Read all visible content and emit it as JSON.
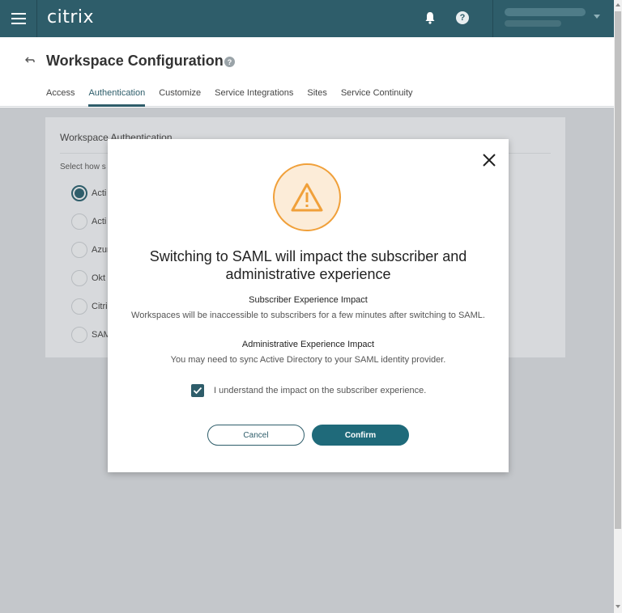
{
  "app": {
    "logo": "citrix",
    "help_icon_glyph": "?",
    "user_name": "",
    "brand_color": "#2e5d6a"
  },
  "header": {
    "title": "Workspace Configuration",
    "title_help_glyph": "?",
    "tabs": [
      {
        "label": "Access",
        "active": false
      },
      {
        "label": "Authentication",
        "active": true
      },
      {
        "label": "Customize",
        "active": false
      },
      {
        "label": "Service Integrations",
        "active": false
      },
      {
        "label": "Sites",
        "active": false
      },
      {
        "label": "Service Continuity",
        "active": false
      }
    ]
  },
  "panel": {
    "title": "Workspace Authentication",
    "description": "Select how s",
    "options": [
      {
        "label": "Acti",
        "checked": true
      },
      {
        "label": "Acti",
        "checked": false
      },
      {
        "label": "Azur",
        "checked": false
      },
      {
        "label": "Okt",
        "checked": false
      },
      {
        "label": "Citri",
        "checked": false
      },
      {
        "label": "SAM",
        "checked": false
      }
    ]
  },
  "modal": {
    "icon": "warning-icon",
    "title": "Switching to SAML will impact the subscriber and administrative experience",
    "subscriber_heading": "Subscriber Experience Impact",
    "subscriber_text": "Workspaces will be inaccessible to subscribers for a few minutes after switching to SAML.",
    "admin_heading": "Administrative Experience Impact",
    "admin_text": "You may need to sync Active Directory to your SAML identity provider.",
    "acknowledge_label": "I understand the impact on the subscriber experience.",
    "acknowledge_checked": true,
    "cancel_label": "Cancel",
    "confirm_label": "Confirm",
    "warning_color": "#f0a03a"
  }
}
